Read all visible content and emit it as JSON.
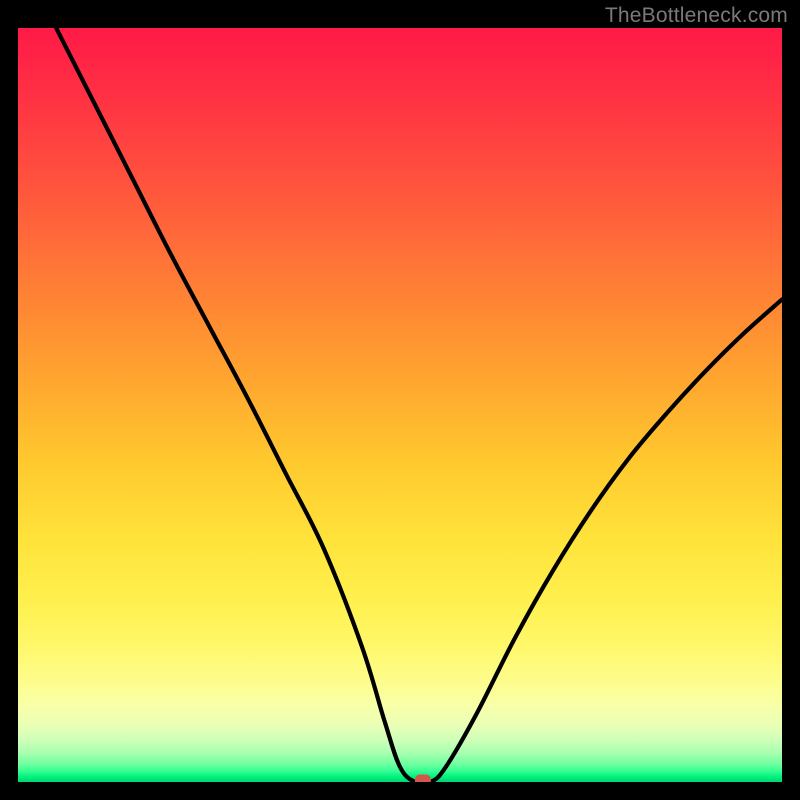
{
  "watermark": "TheBottleneck.com",
  "chart_data": {
    "type": "line",
    "title": "",
    "xlabel": "",
    "ylabel": "",
    "xlim": [
      0,
      100
    ],
    "ylim": [
      0,
      100
    ],
    "series": [
      {
        "name": "bottleneck-curve",
        "x": [
          5,
          10,
          15,
          20,
          25,
          30,
          35,
          40,
          45,
          48,
          50,
          52,
          54,
          56,
          60,
          65,
          70,
          75,
          80,
          85,
          90,
          95,
          100
        ],
        "y": [
          100,
          90,
          80,
          70,
          60.5,
          51,
          41,
          31,
          18,
          8,
          2,
          0,
          0,
          2,
          9,
          19,
          28,
          36,
          43,
          49,
          54.5,
          59.5,
          64
        ]
      }
    ],
    "marker": {
      "x": 53,
      "y": 0
    },
    "background_gradient": {
      "top": "#ff1a47",
      "mid": "#ffe33b",
      "bottom": "#00d670"
    }
  }
}
